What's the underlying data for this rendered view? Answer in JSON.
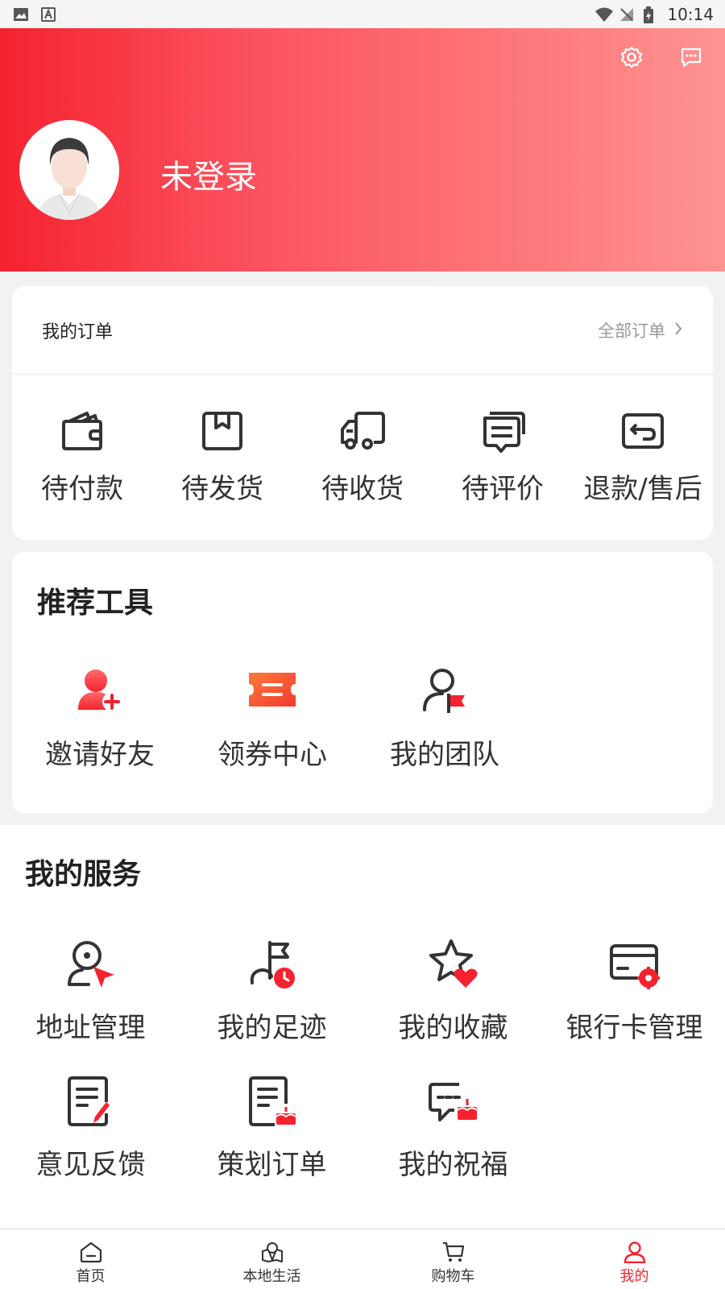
{
  "status_bar": {
    "time": "10:14"
  },
  "header": {
    "login_text": "未登录"
  },
  "orders": {
    "title": "我的订单",
    "all_link": "全部订单",
    "items": [
      {
        "label": "待付款",
        "icon": "wallet-icon"
      },
      {
        "label": "待发货",
        "icon": "package-icon"
      },
      {
        "label": "待收货",
        "icon": "truck-icon"
      },
      {
        "label": "待评价",
        "icon": "comment-icon"
      },
      {
        "label": "退款/售后",
        "icon": "refund-icon"
      }
    ]
  },
  "tools": {
    "title": "推荐工具",
    "items": [
      {
        "label": "邀请好友",
        "icon": "invite-friend-icon"
      },
      {
        "label": "领券中心",
        "icon": "coupon-icon"
      },
      {
        "label": "我的团队",
        "icon": "team-icon"
      }
    ]
  },
  "services": {
    "title": "我的服务",
    "items": [
      {
        "label": "地址管理",
        "icon": "address-icon"
      },
      {
        "label": "我的足迹",
        "icon": "footprint-icon"
      },
      {
        "label": "我的收藏",
        "icon": "favorite-icon"
      },
      {
        "label": "银行卡管理",
        "icon": "bank-card-icon"
      },
      {
        "label": "意见反馈",
        "icon": "feedback-icon"
      },
      {
        "label": "策划订单",
        "icon": "plan-order-icon"
      },
      {
        "label": "我的祝福",
        "icon": "blessing-icon"
      }
    ]
  },
  "tabbar": {
    "items": [
      {
        "label": "首页",
        "icon": "home-icon"
      },
      {
        "label": "本地生活",
        "icon": "local-life-icon"
      },
      {
        "label": "购物车",
        "icon": "cart-icon"
      },
      {
        "label": "我的",
        "icon": "profile-icon",
        "active": true
      }
    ]
  },
  "colors": {
    "brand": "#f5222f",
    "header_end": "#fe9292",
    "coupon": "#fa5a33"
  }
}
